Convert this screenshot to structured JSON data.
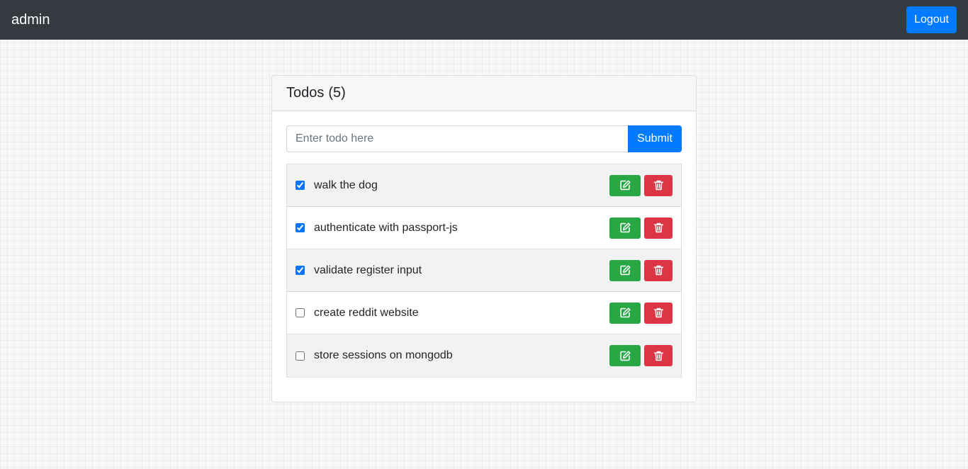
{
  "navbar": {
    "brand": "admin",
    "logout_label": "Logout"
  },
  "card": {
    "title": "Todos",
    "count": "(5)",
    "input_placeholder": "Enter todo here",
    "submit_label": "Submit"
  },
  "todos": [
    {
      "text": "walk the dog",
      "done": true
    },
    {
      "text": "authenticate with passport-js",
      "done": true
    },
    {
      "text": "validate register input",
      "done": true
    },
    {
      "text": "create reddit website",
      "done": false
    },
    {
      "text": "store sessions on mongodb",
      "done": false
    }
  ],
  "icons": {
    "edit": "edit-icon",
    "delete": "trash-icon"
  },
  "colors": {
    "navbar": "#343a40",
    "primary": "#007bff",
    "success": "#28a745",
    "danger": "#dc3545"
  }
}
